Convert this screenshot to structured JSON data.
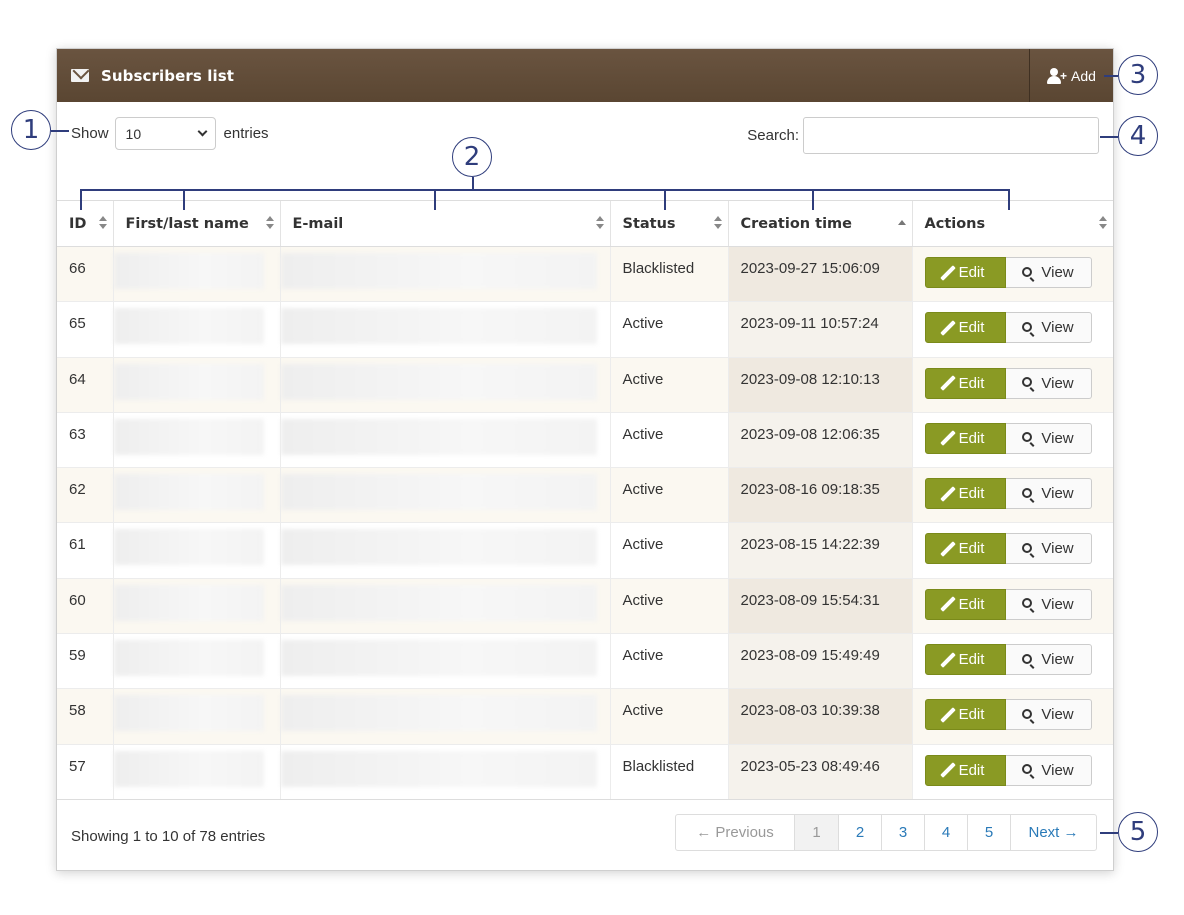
{
  "header": {
    "title": "Subscribers list",
    "add_label": "Add"
  },
  "length": {
    "show_label": "Show",
    "value": "10",
    "entries_label": "entries"
  },
  "search": {
    "label": "Search:",
    "value": ""
  },
  "table": {
    "columns": [
      "ID",
      "First/last name",
      "E-mail",
      "Status",
      "Creation time",
      "Actions"
    ],
    "rows": [
      {
        "id": "66",
        "status": "Blacklisted",
        "created": "2023-09-27 15:06:09"
      },
      {
        "id": "65",
        "status": "Active",
        "created": "2023-09-11 10:57:24"
      },
      {
        "id": "64",
        "status": "Active",
        "created": "2023-09-08 12:10:13"
      },
      {
        "id": "63",
        "status": "Active",
        "created": "2023-09-08 12:06:35"
      },
      {
        "id": "62",
        "status": "Active",
        "created": "2023-08-16 09:18:35"
      },
      {
        "id": "61",
        "status": "Active",
        "created": "2023-08-15 14:22:39"
      },
      {
        "id": "60",
        "status": "Active",
        "created": "2023-08-09 15:54:31"
      },
      {
        "id": "59",
        "status": "Active",
        "created": "2023-08-09 15:49:49"
      },
      {
        "id": "58",
        "status": "Active",
        "created": "2023-08-03 10:39:38"
      },
      {
        "id": "57",
        "status": "Blacklisted",
        "created": "2023-05-23 08:49:46"
      }
    ],
    "edit_label": "Edit",
    "view_label": "View"
  },
  "footer": {
    "info": "Showing 1 to 10 of 78 entries",
    "pager": {
      "previous": "← Previous",
      "pages": [
        "1",
        "2",
        "3",
        "4",
        "5"
      ],
      "next": "Next →"
    }
  },
  "callouts": [
    "1",
    "2",
    "3",
    "4",
    "5"
  ],
  "colors": {
    "header_bg": "#5f4a36",
    "edit_btn": "#8a9a24",
    "callout": "#2f3d7c",
    "link": "#2a7ab8"
  },
  "icons": {
    "header": "envelope-icon",
    "add": "add-user-icon",
    "edit": "pencil-icon",
    "view": "magnifier-icon",
    "dropdown": "chevron-down-icon"
  }
}
